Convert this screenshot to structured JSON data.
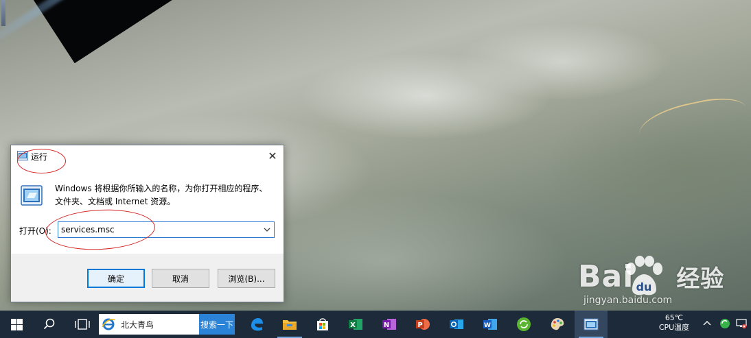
{
  "run_dialog": {
    "title": "运行",
    "close_glyph": "✕",
    "description": "Windows 将根据你所输入的名称，为你打开相应的程序、文件夹、文档或 Internet 资源。",
    "open_label": "打开(O):",
    "open_value": "services.msc",
    "buttons": {
      "ok": "确定",
      "cancel": "取消",
      "browse": "浏览(B)..."
    },
    "icons": [
      "run-icon",
      "close-icon",
      "chevron-down-icon"
    ]
  },
  "taskbar": {
    "search_text": "北大青鸟",
    "search_button": "搜索一下",
    "apps": [
      "windows-start-icon",
      "search-icon",
      "task-view-icon",
      "edge-icon",
      "file-explorer-icon",
      "store-icon",
      "excel-icon",
      "onenote-icon",
      "powerpoint-icon",
      "outlook-icon",
      "word-icon",
      "refresh-app-icon",
      "paint-icon",
      "run-app-icon"
    ],
    "tray": {
      "temperature": "65℃",
      "temperature_label": "CPU温度",
      "icons": [
        "chevron-up-icon",
        "status-icon",
        "network-icon"
      ]
    }
  },
  "watermark": {
    "logo": "Bai",
    "logo_suffix": "经验",
    "url": "jingyan.baidu.com"
  },
  "colors": {
    "taskbar": "#1d2a3a",
    "accent": "#0078d7",
    "annotation": "#d42424",
    "search_button": "#2b83d8"
  }
}
